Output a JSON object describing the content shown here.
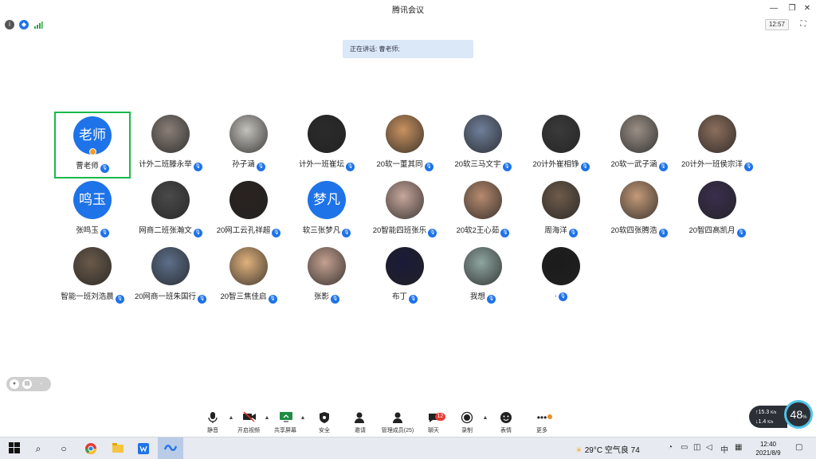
{
  "window": {
    "title": "腾讯会议",
    "minimize": "—",
    "restore": "❐",
    "close": "✕"
  },
  "infobar": {
    "info_icon": "i",
    "shield_icon": "◆",
    "clock": "12:57",
    "fullscreen": "⛶"
  },
  "speaking": "正在讲话: 曹老师;",
  "participants": [
    {
      "name": "曹老师",
      "avatar_text": "老师"
    },
    {
      "name": "计外二班滕永举"
    },
    {
      "name": "孙子涵"
    },
    {
      "name": "计外一班崔坛"
    },
    {
      "name": "20软一董其同"
    },
    {
      "name": "20软三马文宇"
    },
    {
      "name": "20计外崔相铮"
    },
    {
      "name": "20软一武子涵"
    },
    {
      "name": "20计外一班侯宗洋"
    },
    {
      "name": "张鸣玉",
      "avatar_text": "鸣玉"
    },
    {
      "name": "网商二班张瀚文"
    },
    {
      "name": "20网工云孔祥超"
    },
    {
      "name": "软三张梦凡",
      "avatar_text": "梦凡"
    },
    {
      "name": "20智能四班张乐"
    },
    {
      "name": "20软2王心茹"
    },
    {
      "name": "周海洋"
    },
    {
      "name": "20软四张腾浩"
    },
    {
      "name": "20智四高凯月"
    },
    {
      "name": "智能一班刘浩晨"
    },
    {
      "name": "20网商一班朱国行"
    },
    {
      "name": "20智三焦佳启"
    },
    {
      "name": "张影"
    },
    {
      "name": "布丁"
    },
    {
      "name": "我想"
    },
    {
      "name": "."
    }
  ],
  "toolbar": {
    "mute": "静音",
    "video": "开启视频",
    "share": "共享屏幕",
    "security": "安全",
    "invite": "邀请",
    "members": "管理成员(25)",
    "chat": "聊天",
    "chat_badge": "12",
    "record": "录制",
    "emoji": "表情",
    "more": "更多"
  },
  "network": {
    "up": "↑15.3",
    "up_unit": "K/s",
    "down": "↓1.4",
    "down_unit": "K/s",
    "percent": "48",
    "percent_unit": "%"
  },
  "taskbar": {
    "weather": "29°C 空气良 74",
    "ime": "中",
    "time": "12:40",
    "date": "2021/8/9"
  },
  "colors": {
    "accent": "#1e73e8",
    "active_border": "#18b94b",
    "speaking_bg": "#dbe8f7",
    "badge": "#e8392f"
  }
}
